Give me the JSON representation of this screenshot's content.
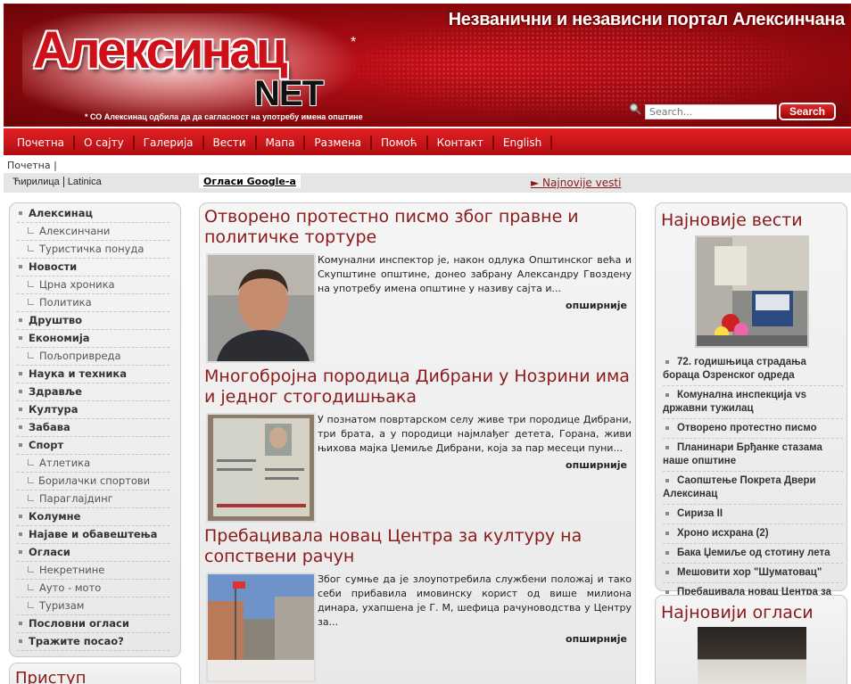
{
  "header": {
    "logo": "Алексинац",
    "logo_star": "*",
    "logo_net": "NET",
    "logo_note": "* СО Алексинац одбила да да сагласност на употребу имена општине",
    "tagline": "Незванични и независни портал Алексинчана",
    "search_placeholder": "Search...",
    "search_button": "Search"
  },
  "nav": {
    "items": [
      "Почетна",
      "О сајту",
      "Галерија",
      "Вести",
      "Мапа",
      "Размена",
      "Помоћ",
      "Контакт",
      "English"
    ]
  },
  "breadcrumb": "Почетна |",
  "toolbar": {
    "cyrillic": "Ћирилица",
    "latin": "Latinica",
    "google_ads": "Огласи Google-a",
    "latest_link": "► Najnovije vesti"
  },
  "sidebar": {
    "items": [
      {
        "label": "Алексинац",
        "level": "top"
      },
      {
        "label": "Алексинчани",
        "level": "sub"
      },
      {
        "label": "Туристичка понуда",
        "level": "sub"
      },
      {
        "label": "Новости",
        "level": "top"
      },
      {
        "label": "Црна хроника",
        "level": "sub"
      },
      {
        "label": "Политика",
        "level": "sub"
      },
      {
        "label": "Друштво",
        "level": "top"
      },
      {
        "label": "Економија",
        "level": "top"
      },
      {
        "label": "Пољопривреда",
        "level": "sub"
      },
      {
        "label": "Наука и техника",
        "level": "top"
      },
      {
        "label": "Здравље",
        "level": "top"
      },
      {
        "label": "Култура",
        "level": "top"
      },
      {
        "label": "Забава",
        "level": "top"
      },
      {
        "label": "Спорт",
        "level": "top"
      },
      {
        "label": "Атлетика",
        "level": "sub"
      },
      {
        "label": "Борилачки спортови",
        "level": "sub two"
      },
      {
        "label": "Параглајдинг",
        "level": "sub"
      },
      {
        "label": "Колумне",
        "level": "top"
      },
      {
        "label": "Најаве и обавештења",
        "level": "top"
      },
      {
        "label": "Огласи",
        "level": "top"
      },
      {
        "label": "Некретнине",
        "level": "sub"
      },
      {
        "label": "Ауто - мото",
        "level": "sub"
      },
      {
        "label": "Туризам",
        "level": "sub"
      },
      {
        "label": "Пословни огласи",
        "level": "top"
      },
      {
        "label": "Тражите посао?",
        "level": "top"
      }
    ]
  },
  "login": {
    "title": "Приступ"
  },
  "articles": [
    {
      "title": "Отворено протестно писмо због правне и политичке тортуре",
      "text": "Комунални инспектор је, након одлука Општинског већа и Скупштине општине, донео забрану Александру Гвоздену на употребу имена општине у називу сајта и...",
      "more": "опширније"
    },
    {
      "title": "Многобројна породица Дибрани у Нозрини има и једног стогодишњака",
      "text": "У познатом повртарском селу живе три породице Дибрани, три брата, а у породици најмлађег детета, Горана, живи њихова мајка Џемиље Дибрани, која за пар месеци пуни...",
      "more": "опширније"
    },
    {
      "title": "Пребацивала новац Центра за културу на сопствени рачун",
      "text": "Због сумње да је злоупотребила службени положај и тако себи прибавила имовинску корист од више милиона динара, ухапшена је Г. М, шефица рачуноводства у Центру за...",
      "more": "опширније"
    }
  ],
  "latest_news": {
    "title": "Најновије вести",
    "items": [
      "72. годишњица страдања бораца Озренског одреда",
      "Комунална инспекција vs државни тужилац",
      "Отворено протестно писмо",
      "Планинари Брђанке стазама наше општине",
      "Саопштење Покрета Двери Алексинац",
      "Сириза II",
      "Хроно исхрана (2)",
      "Бака Џемиље од стотину лета",
      "Мешовити хор \"Шуматовац\"",
      "Пребацивала новац Центра за културу на сопствени рачун"
    ]
  },
  "latest_ads": {
    "title": "Најновији огласи"
  }
}
